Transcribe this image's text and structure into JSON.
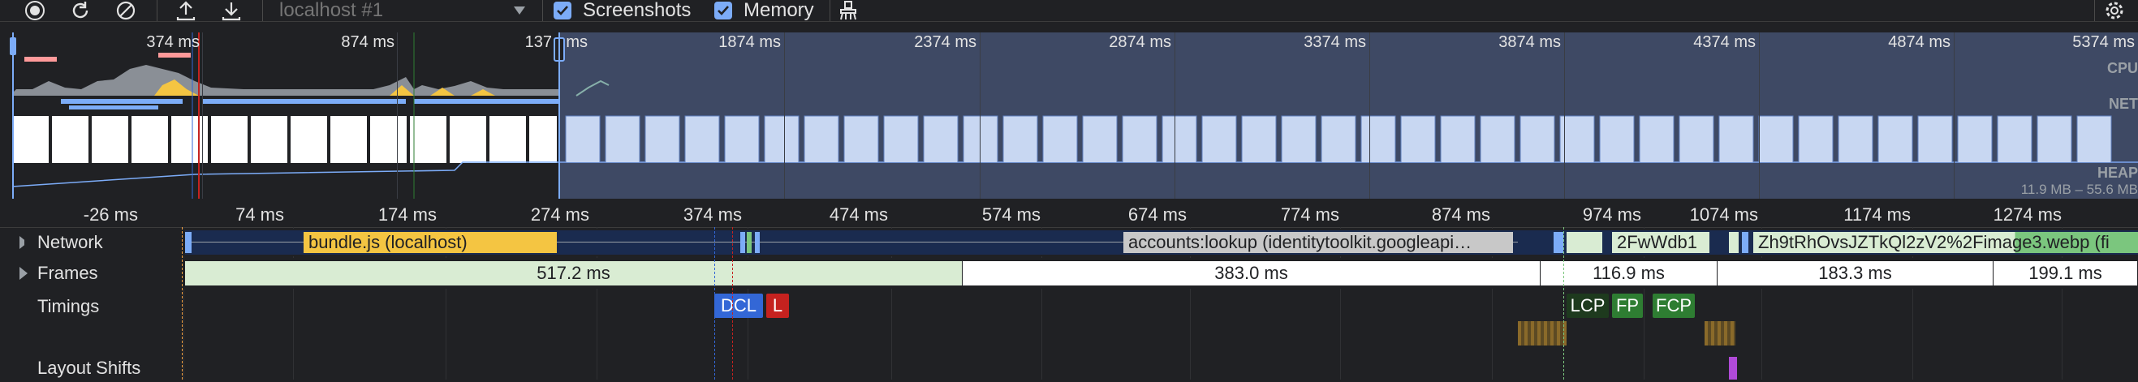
{
  "toolbar": {
    "target": "localhost #1",
    "screenshots_label": "Screenshots",
    "memory_label": "Memory",
    "screenshots_checked": true,
    "memory_checked": true
  },
  "overview": {
    "tick_labels": [
      "374 ms",
      "874 ms",
      "137",
      "ms",
      "1874 ms",
      "2374 ms",
      "2874 ms",
      "3374 ms",
      "3874 ms",
      "4374 ms",
      "4874 ms",
      "5374 ms"
    ],
    "cpu_label": "CPU",
    "net_label": "NET",
    "heap_label": "HEAP",
    "heap_range": "11.9 MB – 55.6 MB"
  },
  "ruler": {
    "labels": [
      "-26 ms",
      "74 ms",
      "174 ms",
      "274 ms",
      "374 ms",
      "474 ms",
      "574 ms",
      "674 ms",
      "774 ms",
      "874 ms",
      "974 ms",
      "1074 ms",
      "1174 ms",
      "1274 ms"
    ]
  },
  "tracks": {
    "network_label": "Network",
    "frames_label": "Frames",
    "timings_label": "Timings",
    "layout_shifts_label": "Layout Shifts"
  },
  "network": {
    "requests": [
      "bundle.js (localhost)",
      "accounts:lookup (identitytoolkit.googleapi…",
      "2FwWdb1",
      "Zh9tRhOvsJZTkQl2zV2%2Fimage3.webp (fi"
    ]
  },
  "frames": {
    "durations": [
      "517.2 ms",
      "383.0 ms",
      "116.9 ms",
      "183.3 ms",
      "199.1 ms"
    ]
  },
  "timings": {
    "markers": [
      "DCL",
      "L",
      "LCP",
      "FP",
      "FCP"
    ]
  },
  "colors": {
    "background": "#202124",
    "accent": "#7cacf8",
    "network_js": "#f4c542",
    "network_xhr": "#c8c8c8",
    "network_img": "#7bc67e",
    "frame_idle": "#d9ecd3",
    "dcl": "#3367d6",
    "load": "#c5221f",
    "lcp": "#1e3a1e",
    "fp": "#2e7d32"
  }
}
